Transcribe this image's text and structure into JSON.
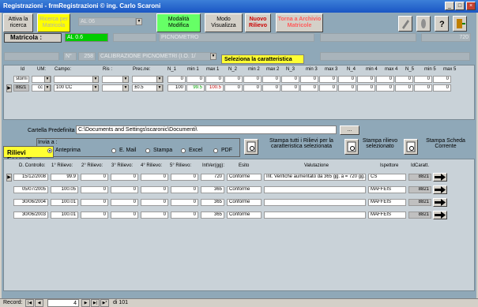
{
  "window": {
    "title": "Registrazioni - frmRegistrazioni © ing. Carlo Scaroni"
  },
  "toolbar": {
    "attiva_ricerca": "Attiva la ricerca",
    "ricerca_matricola": "Ricerca per Matricola",
    "combo_value": "AL 06",
    "modalita": "Modalità Modifica",
    "modo_visualizza": "Modo Visualizza",
    "nuovo_rilievo": "Nuovo Rilievo",
    "torna_archivio": "Torna a Archivio Matricole"
  },
  "matricola": {
    "label": "Matricola :",
    "value": "AL 0.6",
    "descr": "PICNOMETRO",
    "num": "720"
  },
  "calibrazione": {
    "n": "N°",
    "num": "258",
    "descr": "CALIBRAZIONE PICNOMETRI (I.O. 1/",
    "seleziona": "Seleziona la caratteristica"
  },
  "car_headers": [
    "Id",
    "UM:",
    "Campo:",
    "Ris :",
    "Prec.ne:",
    "N_1",
    "min 1",
    "max 1",
    "N_2",
    "min 2",
    "max 2",
    "N_3",
    "min 3",
    "max 3",
    "N_4",
    "min 4",
    "max 4",
    "N_5",
    "min 5",
    "max 5"
  ],
  "car_row1": {
    "id": "storni",
    "nums": [
      "0",
      "0",
      "0",
      "0",
      "0",
      "0",
      "0",
      "0",
      "0",
      "0",
      "0",
      "0",
      "0",
      "0",
      "0"
    ]
  },
  "car_row2": {
    "id": "8821",
    "um": "cc",
    "campo": "100 CC",
    "prec": "±0.5",
    "nums": [
      "100",
      "99.5",
      "100.5",
      "0",
      "0",
      "0",
      "0",
      "0",
      "0",
      "0",
      "0",
      "0",
      "0",
      "0",
      "0"
    ]
  },
  "cartella": {
    "label": "Cartella Predefinita :",
    "value": "C:\\Documents and Settings\\scaronic\\Documenti\\",
    "browse": "..."
  },
  "invia": {
    "label": "Invia a :",
    "options": [
      "Anteprima",
      "E. Mail",
      "Stampa",
      "Excel",
      "PDF"
    ],
    "selected": "Anteprima"
  },
  "stampa": {
    "tutti": "Stampa tutti i Rilievi per la caratteristica selezionata",
    "rilievo": "Stampa rilievo selezionato",
    "scheda": "Stampa Scheda Corrente"
  },
  "rilievi_title": "Rilievi Eseguiti",
  "ril_headers": [
    "D. Controllo:",
    "1° Rilievo:",
    "2° Rilievo:",
    "3° Rilievo:",
    "4° Rilievo:",
    "5° Rilievo:",
    "IntVer(gg):",
    "Esito",
    "Valutazione",
    "Ispettore",
    "IdCaratt."
  ],
  "rilievi": [
    {
      "data": "15/12/2008",
      "r1": "99.9",
      "r2": "0",
      "r3": "0",
      "r4": "0",
      "r5": "0",
      "int": "720",
      "esito": "Conforme",
      "val": "Int. Verifiche aumentato da 365 gg. a = 720 gg.",
      "isp": "CS",
      "id": "8821"
    },
    {
      "data": "05/07/2005",
      "r1": "100.05",
      "r2": "0",
      "r3": "0",
      "r4": "0",
      "r5": "0",
      "int": "365",
      "esito": "Conforme",
      "val": "",
      "isp": "MAFFEIS",
      "id": "8821"
    },
    {
      "data": "30/06/2004",
      "r1": "100.01",
      "r2": "0",
      "r3": "0",
      "r4": "0",
      "r5": "0",
      "int": "365",
      "esito": "Conforme",
      "val": "",
      "isp": "MAFFEIS",
      "id": "8821"
    },
    {
      "data": "30/06/2003",
      "r1": "100.01",
      "r2": "0",
      "r3": "0",
      "r4": "0",
      "r5": "0",
      "int": "365",
      "esito": "Conforme",
      "val": "",
      "isp": "MAFFEIS",
      "id": "8821"
    }
  ],
  "status": {
    "label": "Record:",
    "current": "4",
    "total": "di 101"
  }
}
